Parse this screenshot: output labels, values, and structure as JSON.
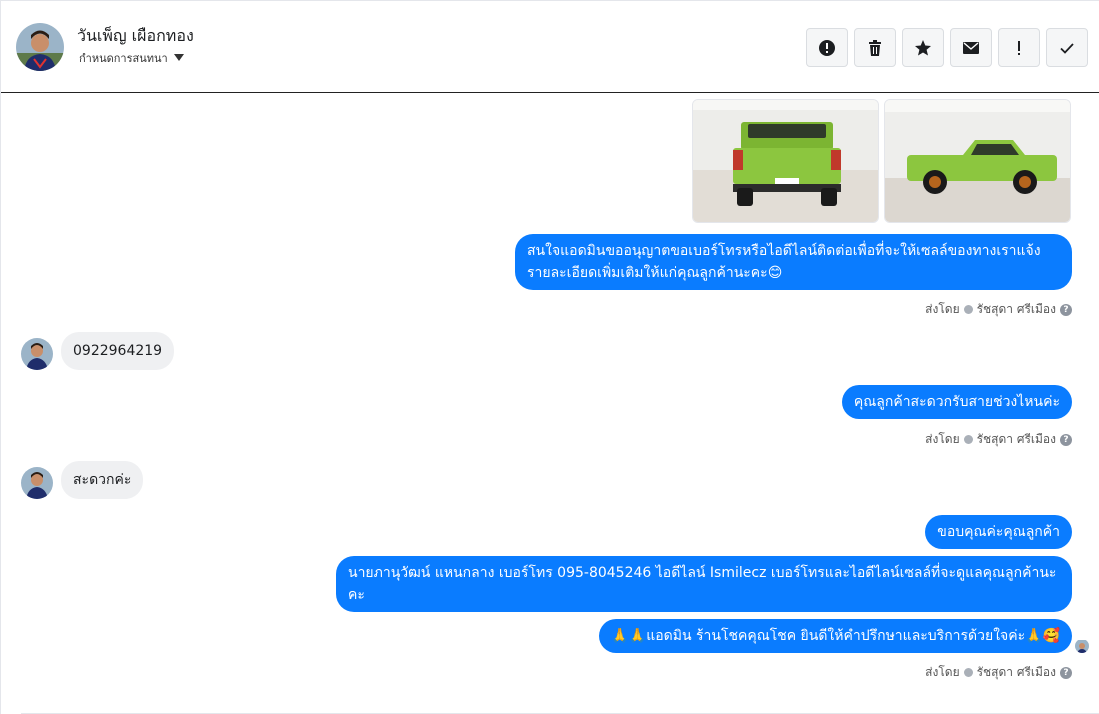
{
  "header": {
    "contact_name": "วันเพ็ญ เผือกทอง",
    "assign_label": "กำหนดการสนทนา",
    "actions": [
      {
        "name": "report-button",
        "icon": "alert-circle-icon"
      },
      {
        "name": "delete-button",
        "icon": "trash-icon"
      },
      {
        "name": "star-button",
        "icon": "star-icon"
      },
      {
        "name": "mark-unread-button",
        "icon": "envelope-icon"
      },
      {
        "name": "important-button",
        "icon": "exclamation-icon"
      },
      {
        "name": "mark-done-button",
        "icon": "checkmark-icon"
      }
    ]
  },
  "messages": {
    "m1": "สนใจแอดมินขออนุญาตขอเบอร์โทรหรือไอดีไลน์ติดต่อเพื่อที่จะให้เซลล์ของทางเราแจ้งรายละเอียดเพิ่มเติมให้แก่คุณลูกค้านะคะ😊",
    "m2": "0922964219",
    "m3": "คุณลูกค้าสะดวกรับสายช่วงไหนค่ะ",
    "m4": "สะดวกค่ะ",
    "m5": "ขอบคุณค่ะคุณลูกค้า",
    "m6": "นายภานุวัฒน์ แหนกลาง เบอร์โทร 095-8045246 ไอดีไลน์ Ismilecz   เบอร์โทรและไอดีไลน์เซลล์ที่จะดูแลคุณลูกค้านะคะ",
    "m7": "🙏🙏แอดมิน ร้านโชคคุณโชค ยินดีให้คำปรึกษาและบริการด้วยใจค่ะ🙏🥰"
  },
  "sent_by": {
    "prefix": "ส่งโดย",
    "agent": "รัชสุดา ศรีเมือง",
    "help": "?"
  },
  "colors": {
    "outgoing_bubble": "#0a7cff",
    "incoming_bubble": "#eff0f2",
    "truck_green": "#8cc63f"
  }
}
